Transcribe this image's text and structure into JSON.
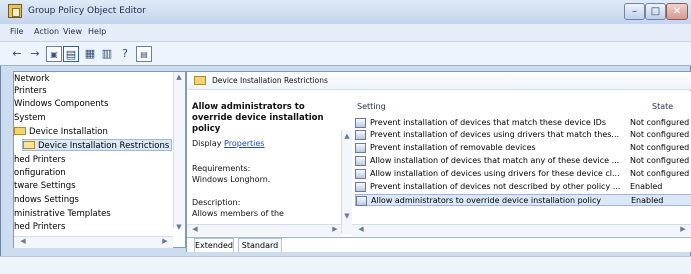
{
  "window": {
    "title": "Group Policy Object Editor",
    "controls": {
      "minimize": "–",
      "maximize": "□",
      "close": "✕"
    }
  },
  "menu": [
    "File",
    "Action",
    "View",
    "Help"
  ],
  "toolbar": [
    "back-icon",
    "forward-icon",
    "up-icon",
    "show-hide-icon",
    "properties-icon",
    "export-icon",
    "help-icon",
    "filter-icon"
  ],
  "tree": {
    "items": [
      {
        "label": "Network"
      },
      {
        "label": "Printers"
      },
      {
        "label": "Windows Components"
      },
      {
        "label": "System"
      },
      {
        "label": "Device Installation"
      },
      {
        "label": "Device Installation Restrictions"
      },
      {
        "label": "hed Printers"
      },
      {
        "label": "onfiguration"
      },
      {
        "label": "tware Settings"
      },
      {
        "label": "ndows Settings"
      },
      {
        "label": "ministrative Templates"
      },
      {
        "label": "hed Printers"
      }
    ]
  },
  "breadcrumb": {
    "label": "Device Installation Restrictions"
  },
  "description": {
    "title": "Allow administrators to override device installation policy",
    "display_label": "Display",
    "display_link": "Properties",
    "requirements_label": "Requirements:",
    "requirements_value": "Windows Longhorn.",
    "description_label": "Description:",
    "description_text": "Allows members of the"
  },
  "list": {
    "header_setting": "Setting",
    "header_state": "State",
    "rows": [
      {
        "setting": "Prevent installation of devices that match these device IDs",
        "state": "Not configured"
      },
      {
        "setting": "Prevent installation of devices using drivers that match thes...",
        "state": "Not configured"
      },
      {
        "setting": "Prevent installation of removable devices",
        "state": "Not configured"
      },
      {
        "setting": "Allow installation of devices that match any of these device ...",
        "state": "Not configured"
      },
      {
        "setting": "Allow installation of devices using drivers for these device cl...",
        "state": "Not configured"
      },
      {
        "setting": "Prevent installation of devices not described by other policy ...",
        "state": "Enabled"
      },
      {
        "setting": "Allow administrators to override device installation policy",
        "state": "Enabled"
      }
    ]
  },
  "tabs": {
    "extended": "Extended",
    "standard": "Standard"
  }
}
